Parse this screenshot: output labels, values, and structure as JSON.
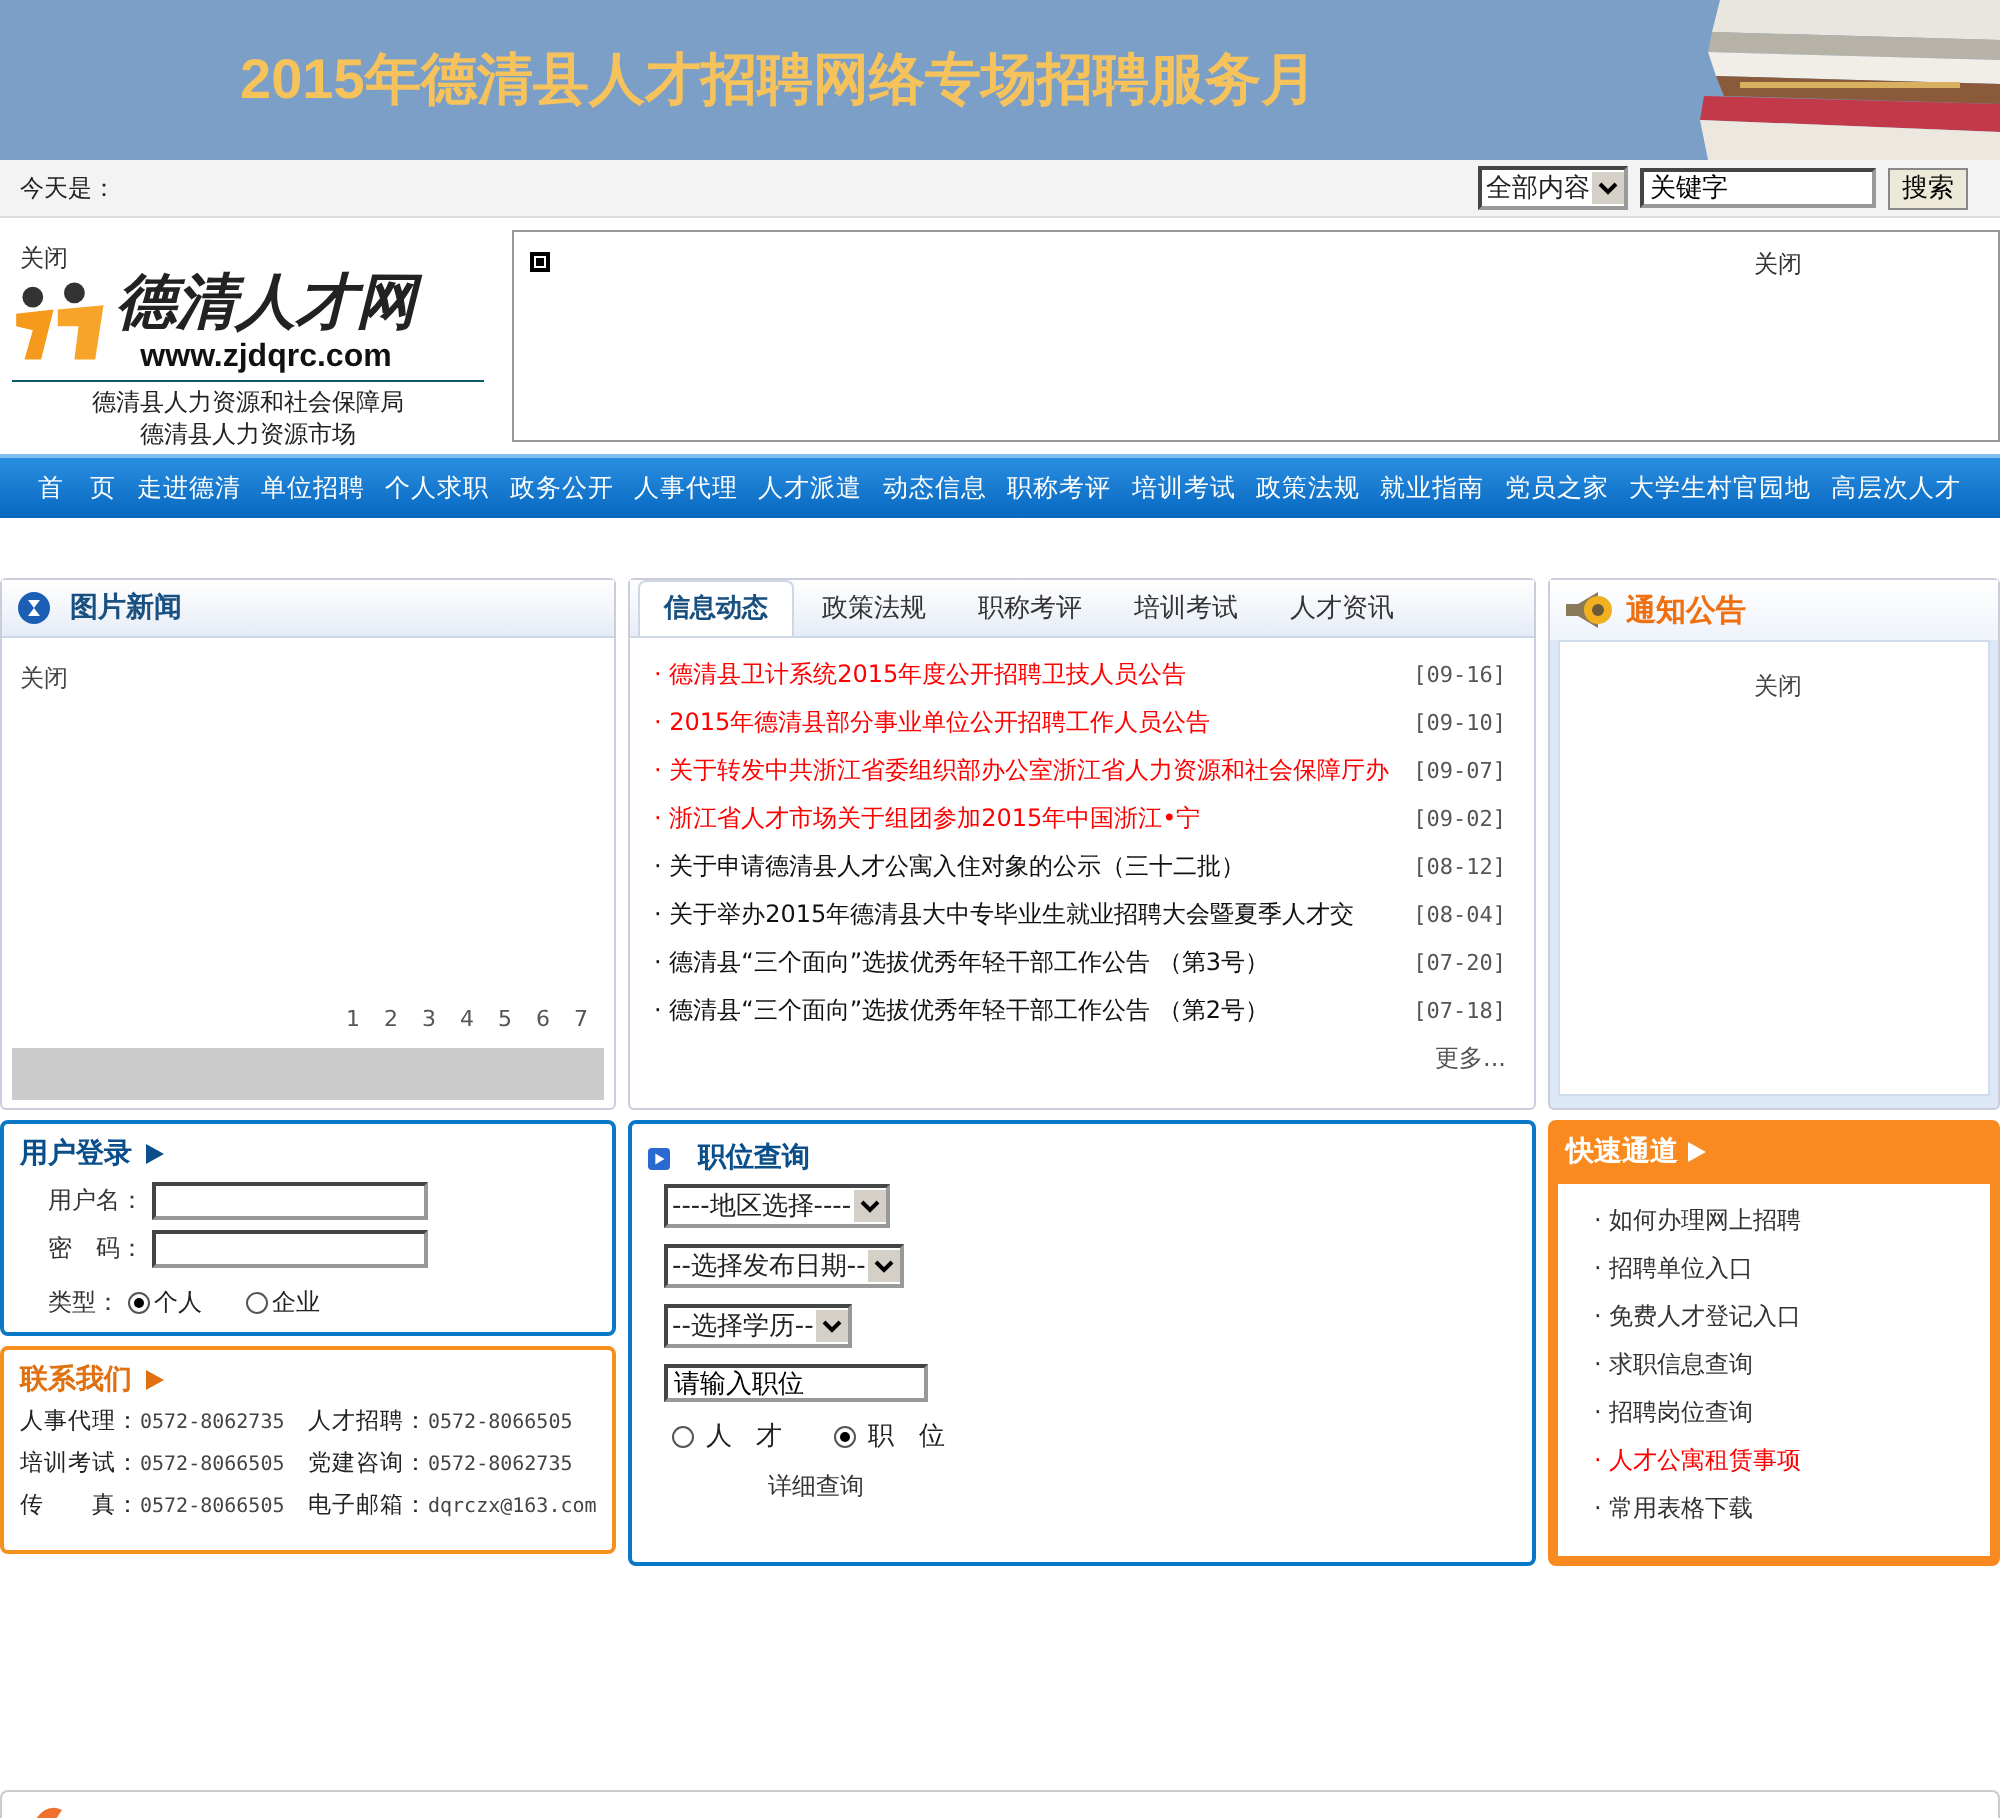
{
  "banner": {
    "title": "2015年德清县人才招聘网络专场招聘服务月"
  },
  "toolbar": {
    "date_label": "今天是：",
    "scope": "全部内容",
    "keyword": "关键字",
    "search_button": "搜索"
  },
  "header": {
    "close_left": "关闭",
    "logo_name": "德清人才网",
    "logo_url": "www.zjdqrc.com",
    "org_lines": [
      "德清县人力资源和社会保障局",
      "德清县人力资源市场"
    ],
    "close_right": "关闭"
  },
  "nav": [
    "首　页",
    "走进德清",
    "单位招聘",
    "个人求职",
    "政务公开",
    "人事代理",
    "人才派遣",
    "动态信息",
    "职称考评",
    "培训考试",
    "政策法规",
    "就业指南",
    "党员之家",
    "大学生村官园地",
    "高层次人才"
  ],
  "photo_news": {
    "title": "图片新闻",
    "close": "关闭",
    "pages": [
      "1",
      "2",
      "3",
      "4",
      "5",
      "6",
      "7"
    ]
  },
  "news": {
    "tabs": [
      {
        "label": "信息动态",
        "selected": true
      },
      {
        "label": "政策法规",
        "selected": false
      },
      {
        "label": "职称考评",
        "selected": false
      },
      {
        "label": "培训考试",
        "selected": false
      },
      {
        "label": "人才资讯",
        "selected": false
      }
    ],
    "items": [
      {
        "title": "· 德清县卫计系统2015年度公开招聘卫技人员公告",
        "date": "[09-16]",
        "highlighted": true
      },
      {
        "title": "· 2015年德清县部分事业单位公开招聘工作人员公告",
        "date": "[09-10]",
        "highlighted": true
      },
      {
        "title": "· 关于转发中共浙江省委组织部办公室浙江省人力资源和社会保障厅办",
        "date": "[09-07]",
        "highlighted": true
      },
      {
        "title": "· 浙江省人才市场关于组团参加2015年中国浙江•宁",
        "date": "[09-02]",
        "highlighted": true
      },
      {
        "title": "· 关于申请德清县人才公寓入住对象的公示（三十二批）",
        "date": "[08-12]",
        "highlighted": false
      },
      {
        "title": "· 关于举办2015年德清县大中专毕业生就业招聘大会暨夏季人才交",
        "date": "[08-04]",
        "highlighted": false
      },
      {
        "title": "· 德清县“三个面向”选拔优秀年轻干部工作公告 （第3号）",
        "date": "[07-20]",
        "highlighted": false
      },
      {
        "title": "· 德清县“三个面向”选拔优秀年轻干部工作公告 （第2号）",
        "date": "[07-18]",
        "highlighted": false
      }
    ],
    "more": "更多..."
  },
  "notices": {
    "title": "通知公告",
    "close": "关闭"
  },
  "login": {
    "title": "用户登录",
    "username_label": "用户名：",
    "password_label": "密　码：",
    "type_label": "类型：",
    "types": [
      {
        "label": "个人",
        "selected": true
      },
      {
        "label": "企业",
        "selected": false
      }
    ]
  },
  "job_search": {
    "title": "职位查询",
    "selects": [
      "----地区选择----",
      "--选择发布日期--",
      "--选择学历--"
    ],
    "keyword": "请输入职位",
    "modes": [
      {
        "label": "人 才",
        "selected": false
      },
      {
        "label": "职 位",
        "selected": true
      }
    ],
    "detail_link": "详细查询"
  },
  "quick_links": {
    "title": "快速通道",
    "items": [
      {
        "label": "· 如何办理网上招聘",
        "highlighted": false
      },
      {
        "label": "· 招聘单位入口",
        "highlighted": false
      },
      {
        "label": "· 免费人才登记入口",
        "highlighted": false
      },
      {
        "label": "· 求职信息查询",
        "highlighted": false
      },
      {
        "label": "· 招聘岗位查询",
        "highlighted": false
      },
      {
        "label": "· 人才公寓租赁事项",
        "highlighted": true
      },
      {
        "label": "· 常用表格下载",
        "highlighted": false
      }
    ]
  },
  "contact": {
    "title": "联系我们",
    "entries": [
      {
        "label": "人事代理：",
        "value": "0572-8062735"
      },
      {
        "label": "人才招聘：",
        "value": "0572-8066505"
      },
      {
        "label": "培训考试：",
        "value": "0572-8066505"
      },
      {
        "label": "党建咨询：",
        "value": "0572-8062735"
      },
      {
        "label": "传　　真：",
        "value": "0572-8066505"
      },
      {
        "label": "电子邮箱：",
        "value": "dqrczx@163.com"
      }
    ]
  }
}
